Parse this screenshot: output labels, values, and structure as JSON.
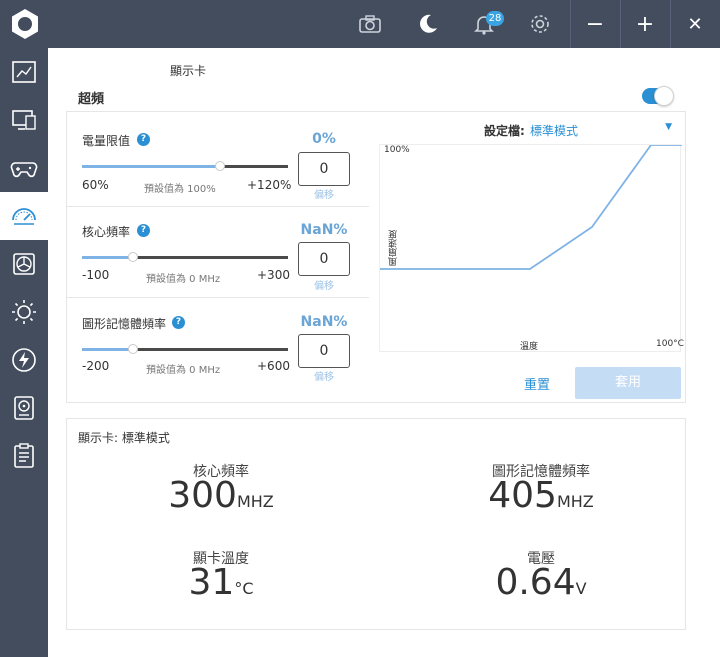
{
  "topbar": {
    "icons": [
      "logo-icon",
      "camera-icon",
      "moon-icon",
      "bell-icon",
      "gear-icon"
    ],
    "notification_count": "28",
    "minimize": "−",
    "maximize": "+",
    "close": "✕"
  },
  "sidebar": {
    "items": [
      "dashboard-icon",
      "monitor-icon",
      "gamepad-icon",
      "speedometer-icon",
      "fan-icon",
      "brightness-icon",
      "lightning-icon",
      "harddrive-icon",
      "clipboard-icon"
    ],
    "active_index": 3
  },
  "header": {
    "subtitle": "顯示卡",
    "section_title": "超頻"
  },
  "sliders": [
    {
      "label": "電量限值",
      "percent": "0%",
      "min": "60%",
      "max": "+120%",
      "default": "預設值為 100%",
      "value": "0",
      "offset": "偏移",
      "fill_fraction": 0.58
    },
    {
      "label": "核心頻率",
      "percent": "NaN%",
      "min": "-100",
      "max": "+300",
      "default": "預設值為 0 MHz",
      "value": "0",
      "offset": "偏移",
      "fill_fraction": 0.25
    },
    {
      "label": "圖形記憶體頻率",
      "percent": "NaN%",
      "min": "-200",
      "max": "+600",
      "default": "預設值為 0 MHz",
      "value": "0",
      "offset": "偏移",
      "fill_fraction": 0.25
    }
  ],
  "profile": {
    "label": "設定檔:",
    "value": "標準模式"
  },
  "fan_chart": {
    "y_top": "100%",
    "y_label": "風扇速度",
    "x_label": "溫度",
    "x_right": "100°C"
  },
  "buttons": {
    "reset": "重置",
    "apply": "套用"
  },
  "status": {
    "title": "顯示卡: 標準模式",
    "core_label": "核心頻率",
    "core_value": "300",
    "core_unit": "MHZ",
    "mem_label": "圖形記憶體頻率",
    "mem_value": "405",
    "mem_unit": "MHZ",
    "temp_label": "顯卡溫度",
    "temp_value": "31",
    "temp_unit": "°C",
    "volt_label": "電壓",
    "volt_value": "0.64",
    "volt_unit": "V"
  },
  "colors": {
    "topbar": "#434d5e",
    "accent": "#2b8fd3",
    "apply_button": "#c5dcf5"
  }
}
